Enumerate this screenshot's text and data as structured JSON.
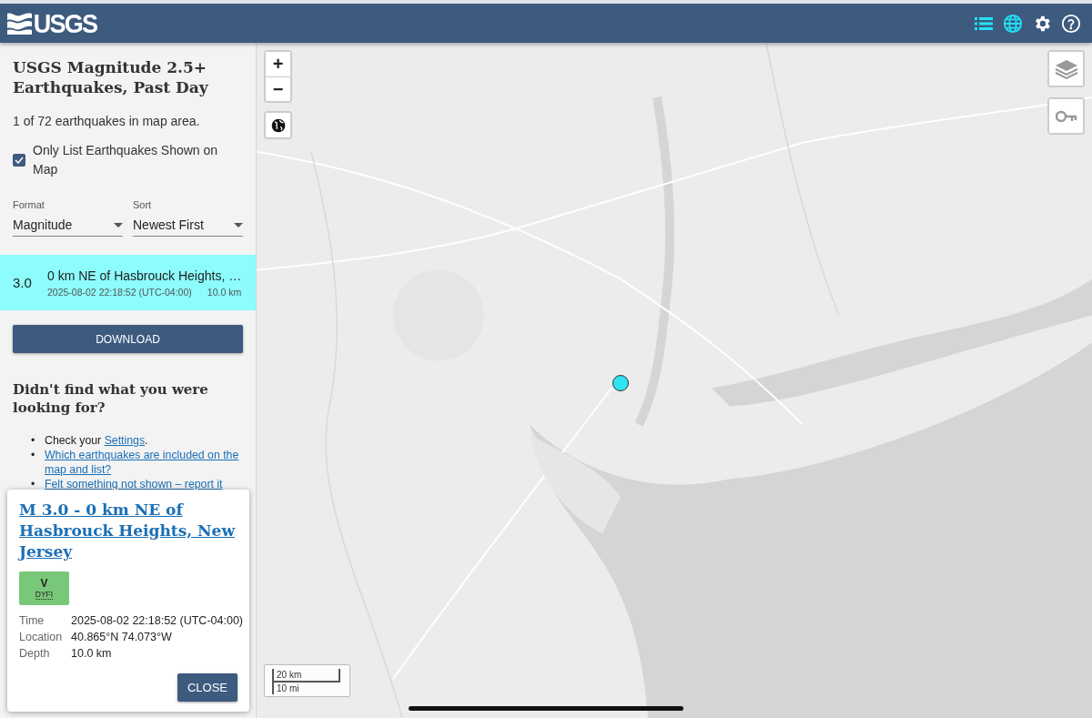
{
  "header": {
    "logo": "USGS",
    "icons": [
      {
        "kind": "list",
        "selected": true
      },
      {
        "kind": "globe",
        "selected": true
      },
      {
        "kind": "settings",
        "selected": false
      },
      {
        "kind": "help",
        "selected": false
      }
    ]
  },
  "sidebar": {
    "title": "USGS Magnitude 2.5+ Earthquakes, Past Day",
    "count": "1 of 72 earthquakes in map area.",
    "only_shown": {
      "label": "Only List Earthquakes Shown on Map",
      "checked": true
    },
    "selects": [
      {
        "label": "Format",
        "value": "Magnitude"
      },
      {
        "label": "Sort",
        "value": "Newest First"
      }
    ],
    "earthquakes": [
      {
        "magnitude": "3.0",
        "place": "0 km NE of Hasbrouck Heights, …",
        "time": "2025-08-02 22:18:52 (UTC-04:00)",
        "depth": "10.0 km",
        "selected": true
      }
    ],
    "download": "DOWNLOAD",
    "help_title": "Didn't find what you were looking for?",
    "help_items": [
      {
        "bullet": "•",
        "text_before": "Check your ",
        "link": "Settings",
        "text_after": "."
      },
      {
        "bullet": "•",
        "link": "Which earthquakes are included on the map and list?"
      },
      {
        "bullet": "•",
        "link": "Felt something not shown – report it"
      }
    ]
  },
  "map": {
    "zoom_in": "+",
    "zoom_out": "−",
    "scale": [
      "20 km",
      "10 mi"
    ]
  },
  "popup": {
    "title": "M 3.0 - 0 km NE of Hasbrouck Heights, New Jersey",
    "dyfi": {
      "value": "V",
      "label": "DYFI"
    },
    "details": [
      {
        "label": "Time",
        "value": "2025-08-02 22:18:52 (UTC-04:00)"
      },
      {
        "label": "Location",
        "value": "40.865°N 74.073°W"
      },
      {
        "label": "Depth",
        "value": "10.0 km"
      }
    ],
    "close": "CLOSE"
  }
}
